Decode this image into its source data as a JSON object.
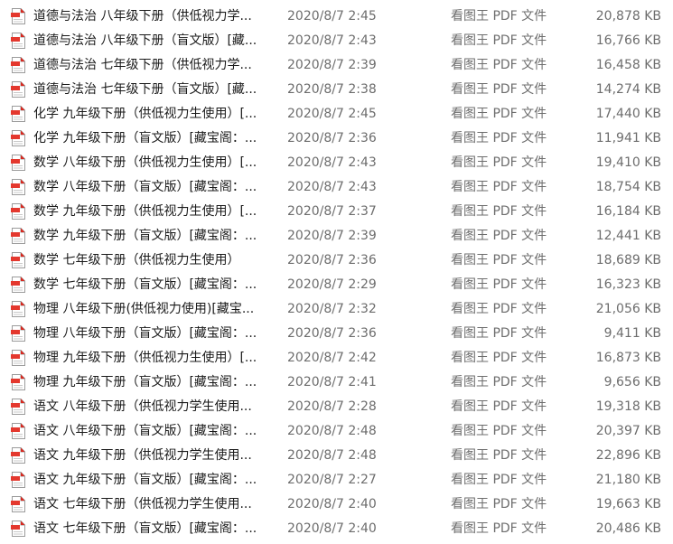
{
  "file_list": {
    "icon": "pdf-file-icon",
    "icon_colors": {
      "fold": "#d8281f",
      "band": "#e4382e",
      "paper": "#ffffff",
      "border": "#9b9b9b"
    },
    "rows": [
      {
        "name": "道德与法治 八年级下册（供低视力学...",
        "date": "2020/8/7 2:45",
        "type": "看图王 PDF 文件",
        "size": "20,878 KB"
      },
      {
        "name": "道德与法治 八年级下册（盲文版）[藏...",
        "date": "2020/8/7 2:43",
        "type": "看图王 PDF 文件",
        "size": "16,766 KB"
      },
      {
        "name": "道德与法治 七年级下册（供低视力学...",
        "date": "2020/8/7 2:39",
        "type": "看图王 PDF 文件",
        "size": "16,458 KB"
      },
      {
        "name": "道德与法治 七年级下册（盲文版）[藏...",
        "date": "2020/8/7 2:38",
        "type": "看图王 PDF 文件",
        "size": "14,274 KB"
      },
      {
        "name": "化学 九年级下册（供低视力生使用）[...",
        "date": "2020/8/7 2:45",
        "type": "看图王 PDF 文件",
        "size": "17,440 KB"
      },
      {
        "name": "化学 九年级下册（盲文版）[藏宝阁：...",
        "date": "2020/8/7 2:36",
        "type": "看图王 PDF 文件",
        "size": "11,941 KB"
      },
      {
        "name": "数学 八年级下册（供低视力生使用）[...",
        "date": "2020/8/7 2:43",
        "type": "看图王 PDF 文件",
        "size": "19,410 KB"
      },
      {
        "name": "数学 八年级下册（盲文版）[藏宝阁：...",
        "date": "2020/8/7 2:43",
        "type": "看图王 PDF 文件",
        "size": "18,754 KB"
      },
      {
        "name": "数学 九年级下册（供低视力生使用）[...",
        "date": "2020/8/7 2:37",
        "type": "看图王 PDF 文件",
        "size": "16,184 KB"
      },
      {
        "name": "数学 九年级下册（盲文版）[藏宝阁：...",
        "date": "2020/8/7 2:39",
        "type": "看图王 PDF 文件",
        "size": "12,441 KB"
      },
      {
        "name": "数学 七年级下册（供低视力生使用）",
        "date": "2020/8/7 2:36",
        "type": "看图王 PDF 文件",
        "size": "18,689 KB"
      },
      {
        "name": "数学 七年级下册（盲文版）[藏宝阁：...",
        "date": "2020/8/7 2:29",
        "type": "看图王 PDF 文件",
        "size": "16,323 KB"
      },
      {
        "name": "物理 八年级下册(供低视力使用)[藏宝...",
        "date": "2020/8/7 2:32",
        "type": "看图王 PDF 文件",
        "size": "21,056 KB"
      },
      {
        "name": "物理 八年级下册（盲文版）[藏宝阁：...",
        "date": "2020/8/7 2:36",
        "type": "看图王 PDF 文件",
        "size": "9,411 KB"
      },
      {
        "name": "物理 九年级下册（供低视力生使用）[...",
        "date": "2020/8/7 2:42",
        "type": "看图王 PDF 文件",
        "size": "16,873 KB"
      },
      {
        "name": "物理 九年级下册（盲文版）[藏宝阁：...",
        "date": "2020/8/7 2:41",
        "type": "看图王 PDF 文件",
        "size": "9,656 KB"
      },
      {
        "name": "语文 八年级下册（供低视力学生使用...",
        "date": "2020/8/7 2:28",
        "type": "看图王 PDF 文件",
        "size": "19,318 KB"
      },
      {
        "name": "语文 八年级下册（盲文版）[藏宝阁：...",
        "date": "2020/8/7 2:48",
        "type": "看图王 PDF 文件",
        "size": "20,397 KB"
      },
      {
        "name": "语文 九年级下册（供低视力学生使用...",
        "date": "2020/8/7 2:48",
        "type": "看图王 PDF 文件",
        "size": "22,896 KB"
      },
      {
        "name": "语文 九年级下册（盲文版）[藏宝阁：...",
        "date": "2020/8/7 2:27",
        "type": "看图王 PDF 文件",
        "size": "21,180 KB"
      },
      {
        "name": "语文 七年级下册（供低视力学生使用...",
        "date": "2020/8/7 2:40",
        "type": "看图王 PDF 文件",
        "size": "19,663 KB"
      },
      {
        "name": "语文 七年级下册（盲文版）[藏宝阁：...",
        "date": "2020/8/7 2:40",
        "type": "看图王 PDF 文件",
        "size": "20,486 KB"
      }
    ]
  }
}
